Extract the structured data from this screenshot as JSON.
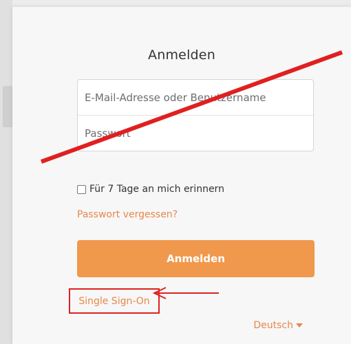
{
  "login": {
    "title": "Anmelden",
    "username_placeholder": "E-Mail-Adresse oder Benutzername",
    "password_placeholder": "Passwort",
    "remember_label": "Für 7 Tage an mich erinnern",
    "forgot_label": "Passwort vergessen?",
    "submit_label": "Anmelden",
    "sso_label": "Single Sign-On",
    "language_label": "Deutsch"
  },
  "colors": {
    "accent": "#f0994c",
    "link": "#e8874a",
    "annotation_red": "#e02020"
  },
  "icons": {
    "language_caret": "caret-down-icon",
    "annotation_arrow": "left-arrow-icon"
  }
}
